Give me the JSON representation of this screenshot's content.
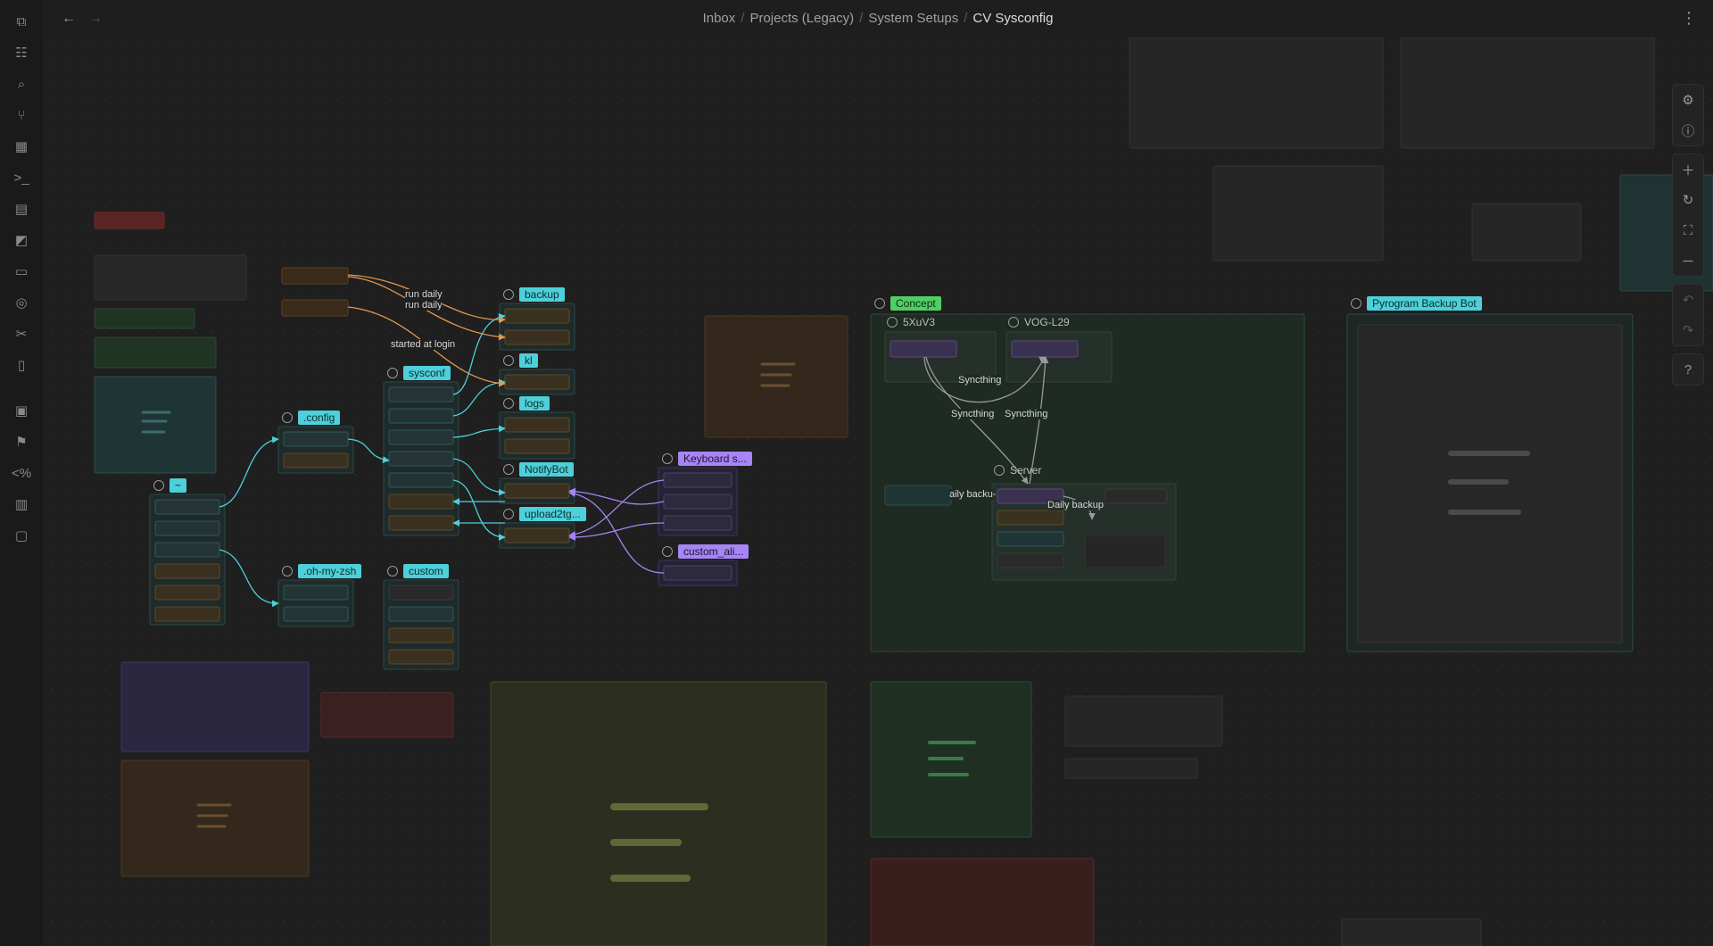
{
  "nav": {
    "back": "←",
    "forward": "→",
    "more": "⋮"
  },
  "breadcrumb": {
    "items": [
      "Inbox",
      "Projects (Legacy)",
      "System Setups"
    ],
    "current": "CV Sysconfig",
    "separator": "/"
  },
  "ribbon": [
    "files-icon",
    "outline-icon",
    "search-doc-icon",
    "graph-icon",
    "dashboard-icon",
    "terminal-icon",
    "layout-icon",
    "canvas-icon",
    "reader-icon",
    "sync-icon",
    "tools-icon",
    "book-icon",
    "calendar-icon",
    "flag-icon",
    "code-icon",
    "calendar-month-icon",
    "calendar-day-icon"
  ],
  "canvas": {
    "groups": {
      "tilde": "~",
      "config": ".config",
      "ohmyzsh": ".oh-my-zsh",
      "custom": "custom",
      "sysconf": "sysconf",
      "backup": "backup",
      "kl": "kl",
      "logs": "logs",
      "notifybot": "NotifyBot",
      "upload": "upload2tg...",
      "keyboard": "Keyboard s...",
      "customali": "custom_ali...",
      "concept": "Concept",
      "device1": "5XuV3",
      "device2": "VOG-L29",
      "server": "Server",
      "pyrogram": "Pyrogram Backup Bot"
    },
    "edge_labels": {
      "run_daily_1": "run daily",
      "run_daily_2": "run daily",
      "login": "started at login",
      "sync1": "Syncthing",
      "sync2": "Syncthing",
      "sync3": "Syncthing",
      "daily1": "aily backu",
      "daily2": "Daily backup"
    }
  },
  "controls": [
    "settings-icon",
    "info-icon",
    "zoom-in-icon",
    "reset-icon",
    "fit-icon",
    "zoom-out-icon",
    "undo-icon",
    "redo-icon",
    "help-icon"
  ],
  "colors": {
    "cyan": "#4dd0d9",
    "purple": "#a685f5",
    "green": "#4fcf63",
    "orange": "#e29a4f",
    "gray": "#888888"
  }
}
